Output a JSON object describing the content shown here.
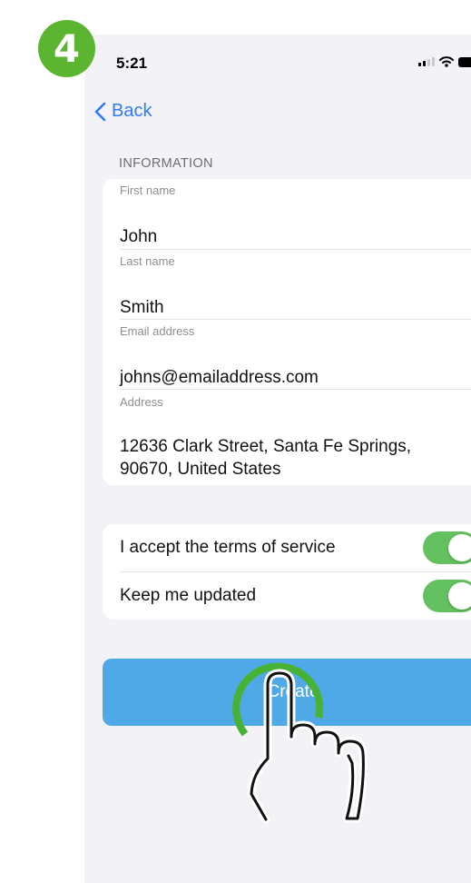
{
  "step_number": "4",
  "status_bar": {
    "time": "5:21"
  },
  "nav": {
    "back_label": "Back"
  },
  "form": {
    "section_header": "INFORMATION",
    "fields": [
      {
        "label": "First name",
        "value": "John"
      },
      {
        "label": "Last name",
        "value": "Smith"
      },
      {
        "label": "Email address",
        "value": "johns@emailaddress.com"
      },
      {
        "label": "Address",
        "value_line1": "12636 Clark Street, Santa Fe Springs,",
        "value_line2": "90670, United States"
      }
    ]
  },
  "toggles": [
    {
      "label": "I accept the terms of service",
      "on": true
    },
    {
      "label": "Keep me updated",
      "on": true
    }
  ],
  "create_button": {
    "label": "Create"
  },
  "colors": {
    "accent_blue": "#2f7cf6",
    "button_blue": "#4fa9e6",
    "toggle_green": "#63c160",
    "badge_green": "#5cb531",
    "ring_green": "#48b235"
  }
}
